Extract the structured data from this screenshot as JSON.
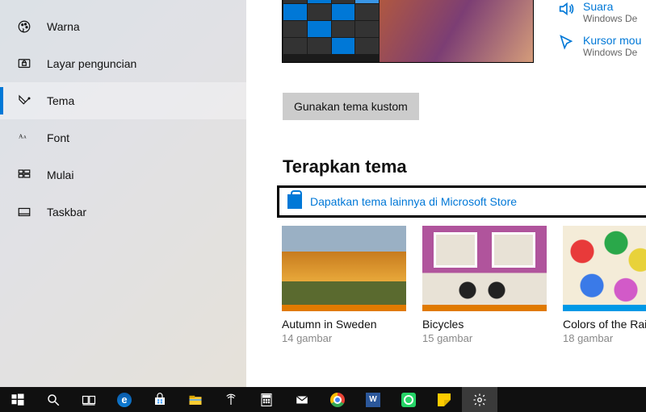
{
  "sidebar": {
    "items": [
      {
        "label": "Warna",
        "icon": "palette-icon"
      },
      {
        "label": "Layar penguncian",
        "icon": "lock-screen-icon"
      },
      {
        "label": "Tema",
        "icon": "themes-icon"
      },
      {
        "label": "Font",
        "icon": "font-icon"
      },
      {
        "label": "Mulai",
        "icon": "start-icon"
      },
      {
        "label": "Taskbar",
        "icon": "taskbar-icon"
      }
    ]
  },
  "main": {
    "custom_button": "Gunakan tema kustom",
    "section_heading": "Terapkan tema",
    "store_link": "Dapatkan tema lainnya di Microsoft Store",
    "themes": [
      {
        "title": "Autumn in Sweden",
        "sub": "14 gambar"
      },
      {
        "title": "Bicycles",
        "sub": "15 gambar"
      },
      {
        "title": "Colors of the Rain",
        "sub": "18 gambar"
      }
    ]
  },
  "related": [
    {
      "title": "Suara",
      "sub": "Windows De",
      "icon": "speaker-icon"
    },
    {
      "title": "Kursor mou",
      "sub": "Windows De",
      "icon": "cursor-icon"
    }
  ],
  "taskbar": {
    "items": [
      "start-button",
      "search-button",
      "task-view-button",
      "edge-icon",
      "store-icon",
      "file-explorer-icon",
      "wifi-app-icon",
      "calculator-icon",
      "mail-icon",
      "chrome-icon",
      "word-icon",
      "whatsapp-icon",
      "sticky-notes-icon",
      "settings-icon"
    ]
  }
}
